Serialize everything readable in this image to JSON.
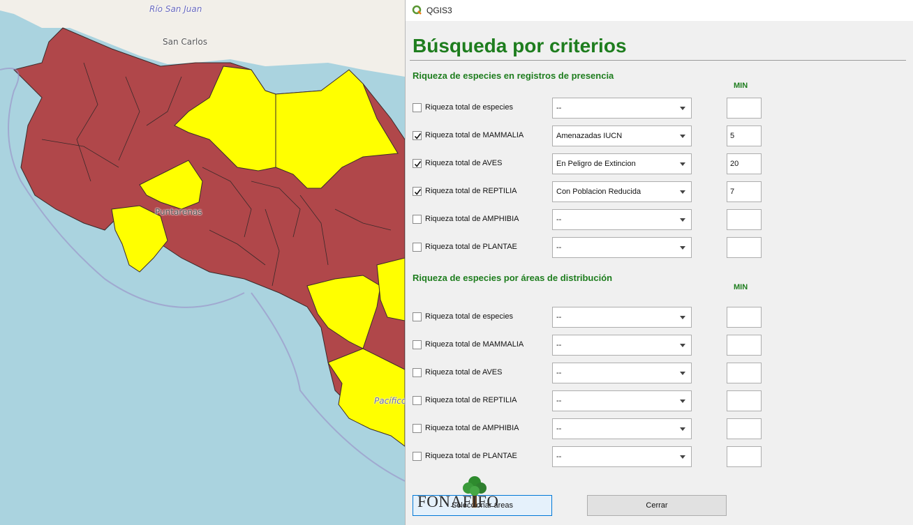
{
  "map": {
    "labels": [
      "Río San Juan",
      "San Carlos",
      "Puntarenas",
      "Pacífico"
    ]
  },
  "window": {
    "title": "QGIS3"
  },
  "dialog": {
    "heading": "Búsqueda por criterios",
    "section1": {
      "title": "Riqueza de especies en registros de presencia",
      "min_label": "MIN",
      "rows": [
        {
          "label": "Riqueza total de especies",
          "checked": false,
          "combo": "--",
          "min": ""
        },
        {
          "label": "Riqueza total de MAMMALIA",
          "checked": true,
          "combo": "Amenazadas IUCN",
          "min": "5"
        },
        {
          "label": "Riqueza total de AVES",
          "checked": true,
          "combo": "En Peligro de Extincion",
          "min": "20"
        },
        {
          "label": "Riqueza total de REPTILIA",
          "checked": true,
          "combo": "Con Poblacion Reducida",
          "min": "7"
        },
        {
          "label": "Riqueza total de AMPHIBIA",
          "checked": false,
          "combo": "--",
          "min": ""
        },
        {
          "label": "Riqueza total de PLANTAE",
          "checked": false,
          "combo": "--",
          "min": ""
        }
      ]
    },
    "section2": {
      "title": "Riqueza de especies por áreas de distribución",
      "min_label": "MIN",
      "rows": [
        {
          "label": "Riqueza total de especies",
          "checked": false,
          "combo": "--",
          "min": ""
        },
        {
          "label": "Riqueza total de MAMMALIA",
          "checked": false,
          "combo": "--",
          "min": ""
        },
        {
          "label": "Riqueza total de AVES",
          "checked": false,
          "combo": "--",
          "min": ""
        },
        {
          "label": "Riqueza total de REPTILIA",
          "checked": false,
          "combo": "--",
          "min": ""
        },
        {
          "label": "Riqueza total de AMPHIBIA",
          "checked": false,
          "combo": "--",
          "min": ""
        },
        {
          "label": "Riqueza total de PLANTAE",
          "checked": false,
          "combo": "--",
          "min": ""
        }
      ]
    },
    "buttons": {
      "select": "Seleccionar áreas",
      "close": "Cerrar"
    },
    "logo": {
      "text": "FONAFIFO"
    }
  },
  "colors": {
    "accent": "#1e7d1e",
    "map_selected": "#ffff00",
    "map_unselected": "#b0474a",
    "water": "#aad3df",
    "land": "#f2efe9"
  }
}
